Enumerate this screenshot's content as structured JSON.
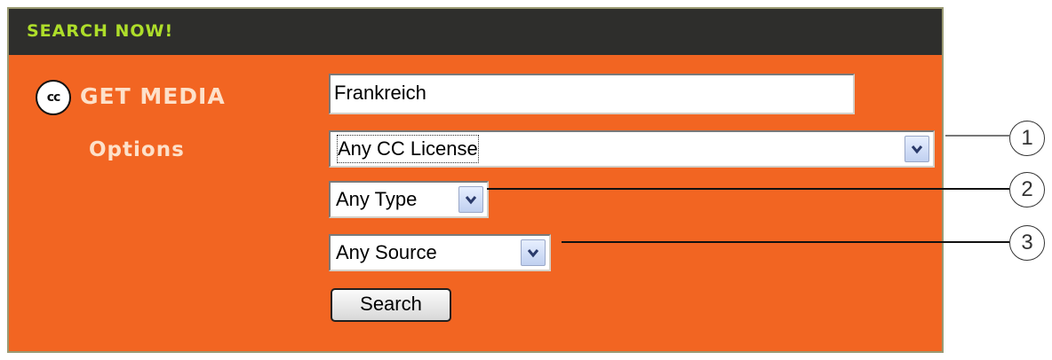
{
  "header": {
    "title": "SEARCH NOW!"
  },
  "sidebar": {
    "logo": "CC logo",
    "logo_text": "cc",
    "get_media": "GET MEDIA",
    "options": "Options"
  },
  "form": {
    "search_value": "Frankreich",
    "license_select": "Any CC License",
    "type_select": "Any Type",
    "source_select": "Any Source",
    "search_button": "Search"
  },
  "callouts": [
    "1",
    "2",
    "3"
  ],
  "colors": {
    "panel": "#f26522",
    "header": "#2e2e2c",
    "header_text": "#aede2a",
    "side_text": "#fde0c9"
  },
  "icons": {
    "dropdown": "chevron-down-icon"
  }
}
